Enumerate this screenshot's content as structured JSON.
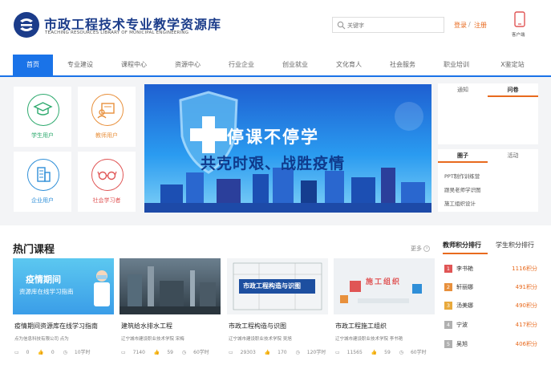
{
  "header": {
    "title": "市政工程技术专业教学资源库",
    "subtitle": "TEACHING RESOURCES LIBRARY OF MUNICIPAL ENGINEERING",
    "search_placeholder": "关键字",
    "login": "登录",
    "separator": "/",
    "register": "注册",
    "client_label": "客户端"
  },
  "nav": {
    "items": [
      "首页",
      "专业建设",
      "课程中心",
      "资源中心",
      "行业企业",
      "创业就业",
      "文化育人",
      "社会服务",
      "职业培训",
      "X鉴定站"
    ]
  },
  "roles": [
    {
      "label": "学生用户",
      "icon": "graduation-cap-icon",
      "color": "#2eaa6e"
    },
    {
      "label": "教师用户",
      "icon": "teacher-board-icon",
      "color": "#e8903c"
    },
    {
      "label": "企业用户",
      "icon": "building-icon",
      "color": "#2f8fd8"
    },
    {
      "label": "社会学习者",
      "icon": "glasses-icon",
      "color": "#e05555"
    }
  ],
  "banner": {
    "line1": "停课不停学",
    "line2": "共克时艰、战胜疫情"
  },
  "panel_top": {
    "tabs": [
      "通知",
      "问卷"
    ],
    "active": 1
  },
  "panel_bottom": {
    "tabs": [
      "圈子",
      "活动"
    ],
    "active": 0,
    "items": [
      "PPT制作训练营",
      "跟吴老师学识图",
      "施工组织设计"
    ]
  },
  "hot": {
    "title": "热门课程",
    "more": "更多",
    "courses": [
      {
        "title": "疫情期间资源库在线学习指南",
        "school": "点为信息科技有限公司  点为",
        "views": "0",
        "likes": "0",
        "duration": "10学时",
        "thumb_line1": "疫情期间",
        "thumb_line2": "资源库在线学习指南"
      },
      {
        "title": "建筑给水排水工程",
        "school": "辽宁城市建设职业技术学院  宋梅",
        "views": "7140",
        "likes": "59",
        "duration": "60学时"
      },
      {
        "title": "市政工程构造与识图",
        "school": "辽宁城市建设职业技术学院  吴旭",
        "views": "29303",
        "likes": "170",
        "duration": "120学时",
        "thumb_text": "市政工程构造与识图"
      },
      {
        "title": "市政工程施工组织",
        "school": "辽宁城市建设职业技术学院  李书艳",
        "views": "11565",
        "likes": "59",
        "duration": "60学时",
        "thumb_text": "施工组织"
      }
    ]
  },
  "ranking": {
    "tabs": [
      "教师积分排行",
      "学生积分排行"
    ],
    "rows": [
      {
        "rank": "1",
        "name": "李书艳",
        "score": "1116积分",
        "color": "#e05555"
      },
      {
        "rank": "2",
        "name": "轩丽娜",
        "score": "491积分",
        "color": "#e8903c"
      },
      {
        "rank": "3",
        "name": "汤美娜",
        "score": "490积分",
        "color": "#e8a93c"
      },
      {
        "rank": "4",
        "name": "宁波",
        "score": "417积分",
        "color": "#b0b0b0"
      },
      {
        "rank": "5",
        "name": "吴旭",
        "score": "406积分",
        "color": "#b0b0b0"
      }
    ]
  }
}
